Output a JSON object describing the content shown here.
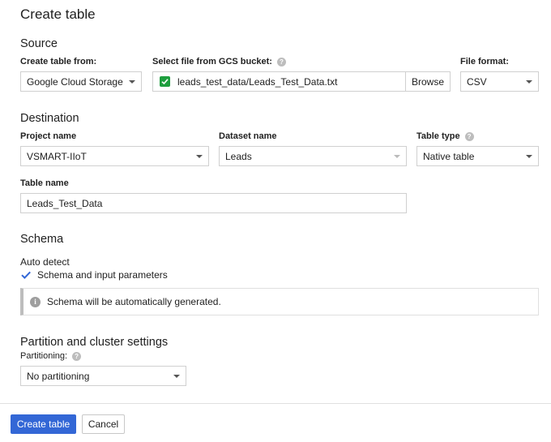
{
  "page": {
    "title": "Create table"
  },
  "source": {
    "section_title": "Source",
    "create_from_label": "Create table from:",
    "create_from_value": "Google Cloud Storage",
    "gcs_label": "Select file from GCS bucket:",
    "gcs_value": "leads_test_data/Leads_Test_Data.txt",
    "browse_label": "Browse",
    "format_label": "File format:",
    "format_value": "CSV"
  },
  "destination": {
    "section_title": "Destination",
    "project_label": "Project name",
    "project_value": "VSMART-IIoT",
    "dataset_label": "Dataset name",
    "dataset_value": "Leads",
    "table_type_label": "Table type",
    "table_type_value": "Native table",
    "table_name_label": "Table name",
    "table_name_value": "Leads_Test_Data"
  },
  "schema": {
    "section_title": "Schema",
    "auto_detect_label": "Auto detect",
    "checkbox_label": "Schema and input parameters",
    "checked": true,
    "info_text": "Schema will be automatically generated."
  },
  "partition": {
    "section_title": "Partition and cluster settings",
    "partitioning_label": "Partitioning:",
    "partitioning_value": "No partitioning"
  },
  "actions": {
    "create_label": "Create table",
    "cancel_label": "Cancel"
  },
  "colors": {
    "primary": "#3367d6",
    "success": "#1e9e3e",
    "checkbox": "#3367d6"
  },
  "icons": {
    "help": "help-icon",
    "info": "info-icon",
    "check": "check-icon",
    "dropdown": "chevron-down-icon"
  }
}
